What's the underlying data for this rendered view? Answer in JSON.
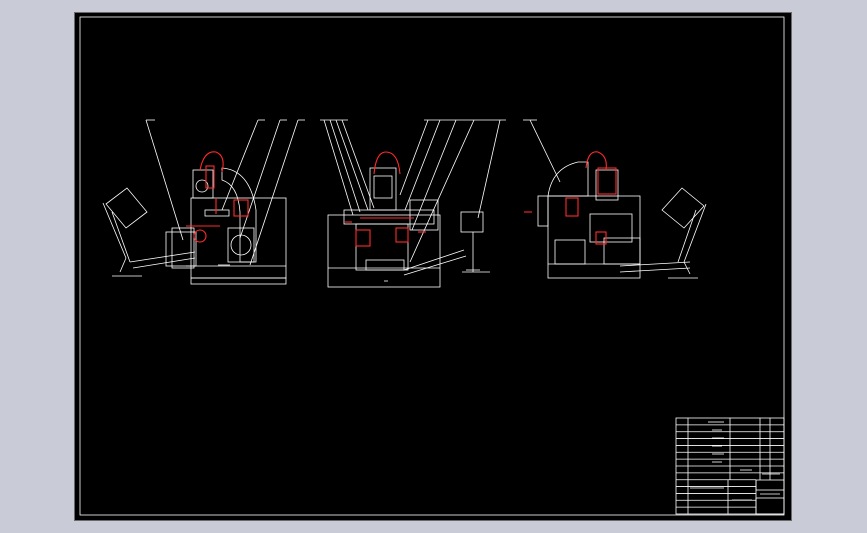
{
  "drawing": {
    "background": "#c9cbd6",
    "sheet_color": "#000000",
    "line_color": "#ffffff",
    "highlight_color": "#ff2a2a"
  },
  "views": [
    {
      "name": "left-side-view"
    },
    {
      "name": "front-view"
    },
    {
      "name": "right-side-view"
    }
  ],
  "title_block": {
    "rows": 14
  }
}
